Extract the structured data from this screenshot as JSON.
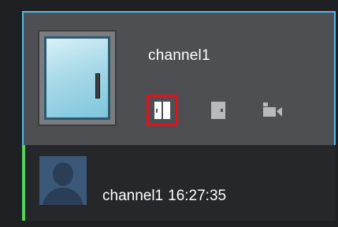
{
  "channel": {
    "name": "channel1"
  },
  "actions": {
    "open_door": {
      "icon": "door-open-icon",
      "selected": true
    },
    "close_door": {
      "icon": "door-closed-icon",
      "selected": false
    },
    "camera": {
      "icon": "video-camera-icon",
      "selected": false
    }
  },
  "event": {
    "channel": "channel1",
    "time": "16:27:35",
    "avatar_icon": "user-avatar-icon"
  },
  "colors": {
    "card_border": "#55b9e6",
    "selection_outline": "#e3111b",
    "event_indicator": "#55d35a"
  }
}
